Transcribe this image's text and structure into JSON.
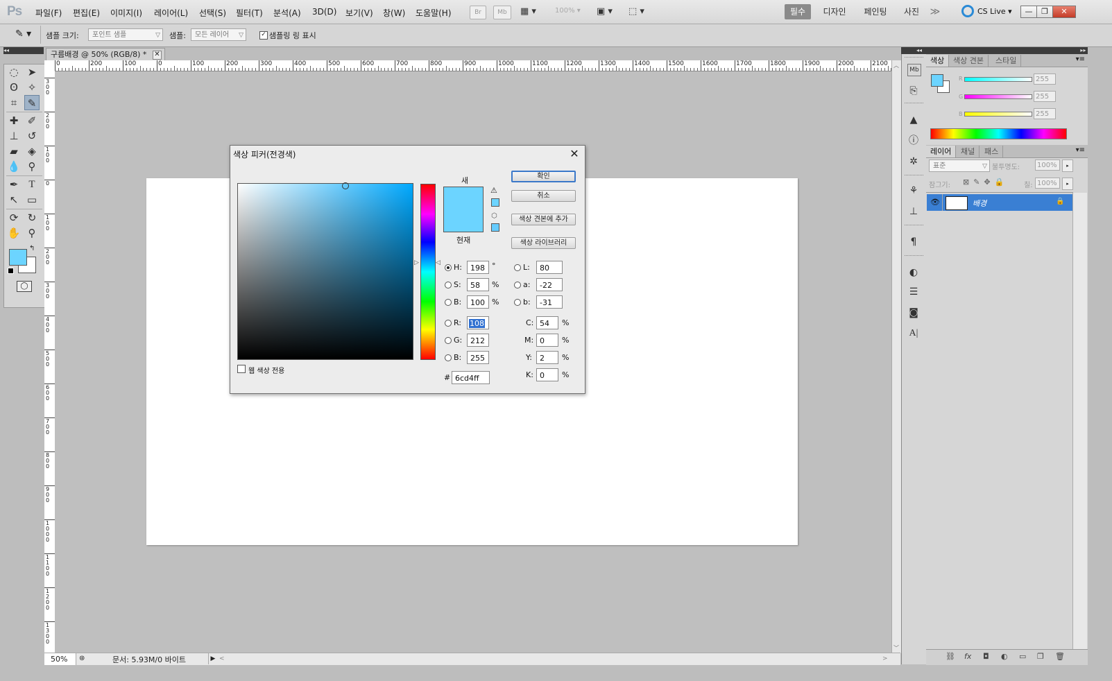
{
  "app": {
    "logo": "Ps",
    "menus": [
      "파일(F)",
      "편집(E)",
      "이미지(I)",
      "레이어(L)",
      "선택(S)",
      "필터(T)",
      "분석(A)",
      "3D(D)",
      "보기(V)",
      "창(W)",
      "도움말(H)"
    ],
    "bridge_btn": "Br",
    "minibridge_btn": "Mb",
    "zoom_level": "100%",
    "workspaces": [
      "필수",
      "디자인",
      "페인팅",
      "사진"
    ],
    "more": "≫",
    "cs_live": "CS Live",
    "window_controls": [
      "—",
      "❐",
      "✕"
    ]
  },
  "options": {
    "sample_size_label": "샘플 크기:",
    "sample_size_value": "포인트 샘플",
    "sample_label": "샘플:",
    "sample_value": "모든 레이어",
    "show_ring_label": "샘플링 링 표시",
    "show_ring_checked": true
  },
  "document": {
    "tab_title": "구름배경 @ 50% (RGB/8) *",
    "zoom": "50%",
    "status": "문서: 5.93M/0 바이트",
    "ruler_h_labels": [
      "0",
      "200",
      "100",
      "0",
      "100",
      "200",
      "300",
      "400",
      "500",
      "600",
      "700",
      "800",
      "900",
      "1000",
      "1100",
      "1200",
      "1300",
      "1400",
      "1500",
      "1600",
      "1700",
      "1800",
      "1900",
      "2000",
      "2100"
    ],
    "ruler_v_labels": [
      "300",
      "200",
      "100",
      "0",
      "100",
      "200",
      "300",
      "400",
      "500",
      "600",
      "700",
      "800",
      "900",
      "1000",
      "1100",
      "1200",
      "1300"
    ]
  },
  "toolbox": {
    "foreground_color": "#6cd4ff",
    "background_color": "#ffffff"
  },
  "panels": {
    "color_tabs": [
      "색상",
      "색상 견본",
      "스타일"
    ],
    "color_panel": {
      "r_label": "R",
      "g_label": "G",
      "b_label": "B",
      "r": "255",
      "g": "255",
      "b": "255"
    },
    "layer_tabs": [
      "레이어",
      "채널",
      "패스"
    ],
    "blend_mode": "표준",
    "opacity_label": "불투명도:",
    "opacity": "100%",
    "lock_label": "잠그기:",
    "fill_label": "칠:",
    "fill": "100%",
    "layer_name": "배경"
  },
  "dialog": {
    "title": "색상 피커(전경색)",
    "new_label": "새",
    "current_label": "현재",
    "new_color": "#6cd4ff",
    "current_color": "#6cd4ff",
    "buttons": {
      "ok": "확인",
      "cancel": "취소",
      "add_swatch": "색상 견본에 추가",
      "libraries": "색상 라이브러리"
    },
    "web_only_label": "웹 색상 전용",
    "web_only_checked": false,
    "fields": {
      "H": "198",
      "S": "58",
      "B": "100",
      "R": "108",
      "G": "212",
      "Bl": "255",
      "L": "80",
      "a": "-22",
      "b": "-31",
      "C": "54",
      "M": "0",
      "Y": "2",
      "K": "0"
    },
    "labels": {
      "H": "H:",
      "S": "S:",
      "B": "B:",
      "R": "R:",
      "G": "G:",
      "Bl": "B:",
      "L": "L:",
      "a": "a:",
      "b": "b:",
      "C": "C:",
      "M": "M:",
      "Y": "Y:",
      "K": "K:"
    },
    "units": {
      "deg": "°",
      "pct": "%"
    },
    "hex_label": "#",
    "hex": "6cd4ff",
    "selected_mode": "H"
  }
}
